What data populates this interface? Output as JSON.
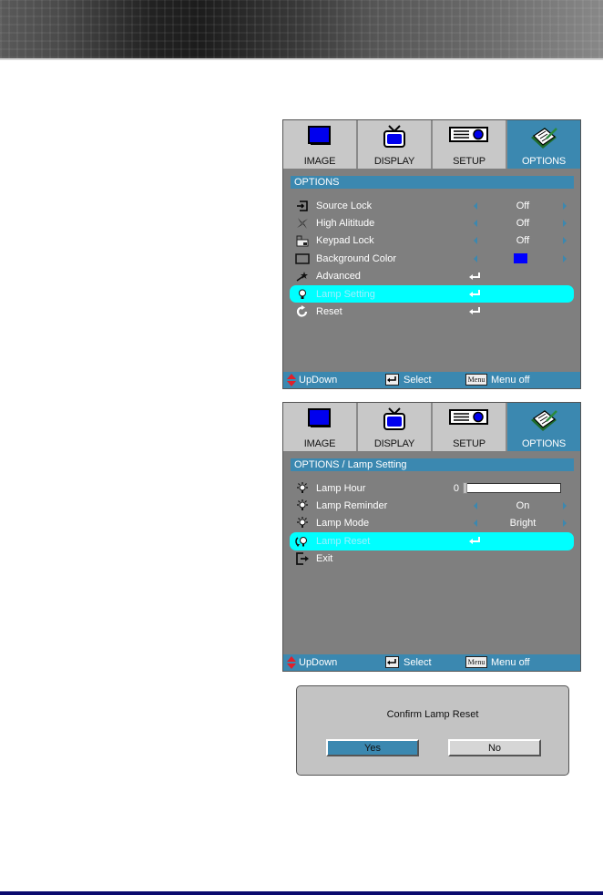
{
  "colors": {
    "accent": "#3b88b0",
    "highlight": "#00ffff",
    "panel": "#7f7f7f",
    "tab_inactive": "#c8c8c8",
    "swatch_blue": "#0000ff",
    "bottom_rule": "#0b0b6e"
  },
  "tabs": [
    {
      "label": "IMAGE",
      "icon": "monitor-icon"
    },
    {
      "label": "DISPLAY",
      "icon": "tv-icon"
    },
    {
      "label": "SETUP",
      "icon": "projector-icon"
    },
    {
      "label": "OPTIONS",
      "icon": "notepad-pen-icon",
      "active": true
    }
  ],
  "menu1": {
    "breadcrumb": "OPTIONS",
    "items": [
      {
        "label": "Source Lock",
        "icon": "source-lock-icon",
        "value": "Off",
        "type": "select"
      },
      {
        "label": "High Alititude",
        "icon": "fan-icon",
        "value": "Off",
        "type": "select"
      },
      {
        "label": "Keypad Lock",
        "icon": "keypad-icon",
        "value": "Off",
        "type": "select"
      },
      {
        "label": "Background Color",
        "icon": "background-icon",
        "value": "Blue",
        "type": "color"
      },
      {
        "label": "Advanced",
        "icon": "star-wand-icon",
        "type": "enter"
      },
      {
        "label": "Lamp Setting",
        "icon": "bulb-icon",
        "type": "enter",
        "selected": true
      },
      {
        "label": "Reset",
        "icon": "reset-icon",
        "type": "enter"
      }
    ]
  },
  "menu2": {
    "breadcrumb": "OPTIONS / Lamp Setting",
    "items": [
      {
        "label": "Lamp Hour",
        "icon": "lamp-glow-icon",
        "value": "0",
        "type": "slider",
        "level": 0
      },
      {
        "label": "Lamp Reminder",
        "icon": "lamp-glow-icon",
        "value": "On",
        "type": "select"
      },
      {
        "label": "Lamp Mode",
        "icon": "lamp-glow-icon",
        "value": "Bright",
        "type": "select"
      },
      {
        "label": "Lamp Reset",
        "icon": "lamp-reset-icon",
        "type": "enter",
        "selected": true
      },
      {
        "label": "Exit",
        "icon": "exit-icon",
        "type": "plain"
      }
    ]
  },
  "footer": {
    "updown": "UpDown",
    "select": "Select",
    "menu_key": "Menu",
    "menu_off": "Menu off"
  },
  "dialog": {
    "title": "Confirm Lamp Reset",
    "yes": "Yes",
    "no": "No"
  }
}
